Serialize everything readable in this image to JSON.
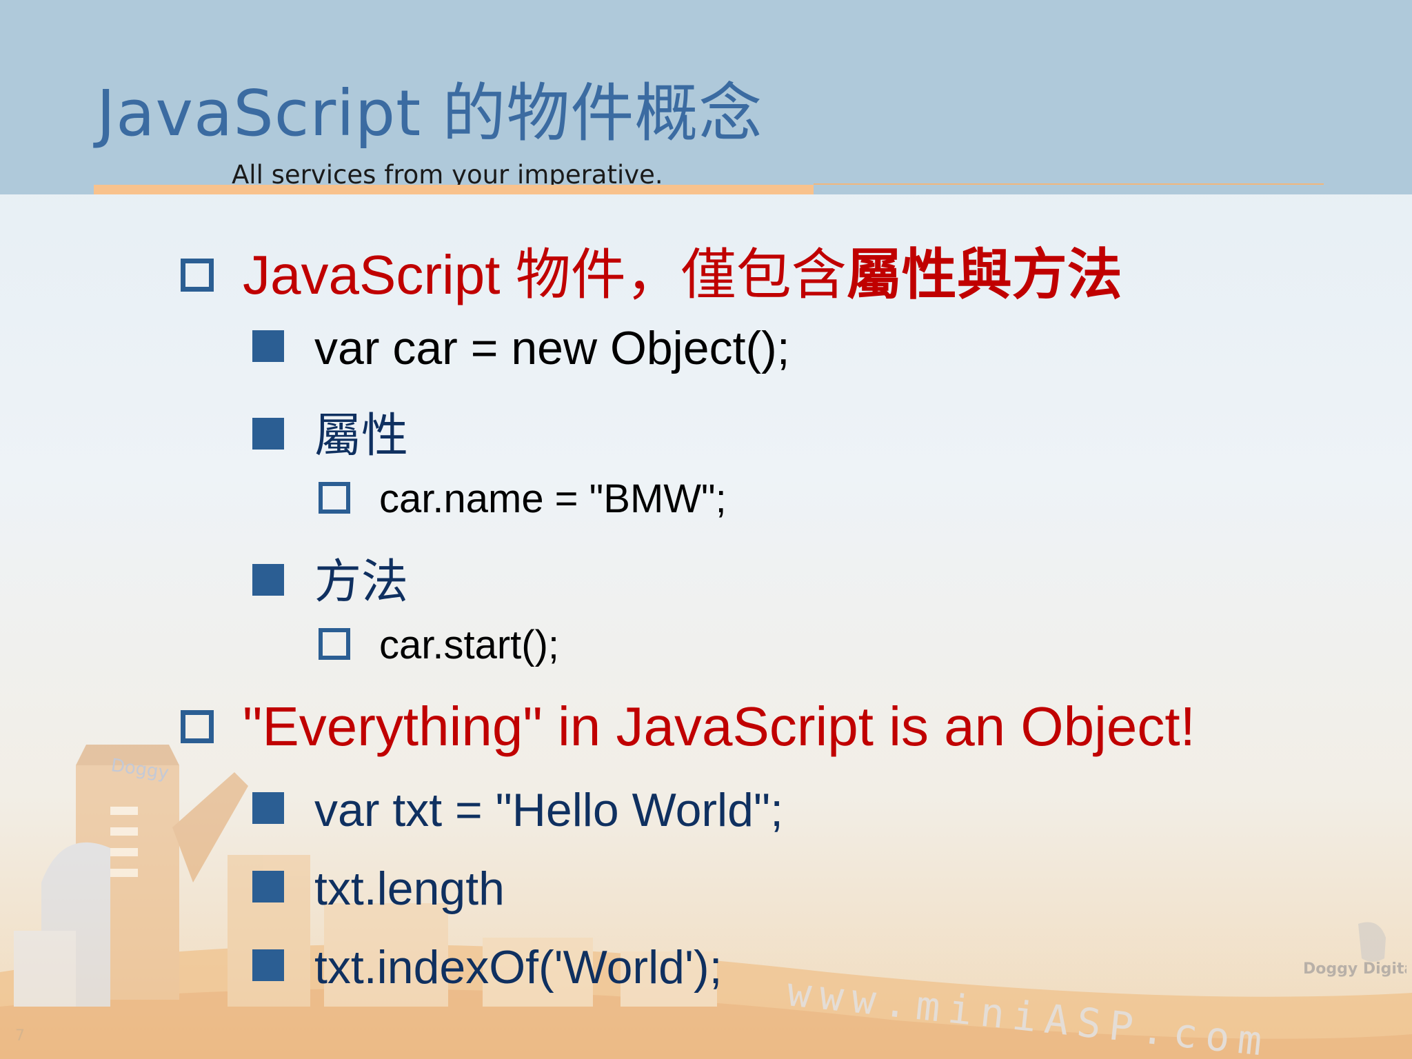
{
  "title": "JavaScript 的物件概念",
  "subtitle": "All services from your imperative.",
  "bullets": {
    "b1": {
      "prefix": "JavaScript 物件，僅包含",
      "emph": "屬性與方法"
    },
    "b1_1": "var car = new Object();",
    "b1_2": "屬性",
    "b1_2_1": "car.name = \"BMW\";",
    "b1_3": "方法",
    "b1_3_1": "car.start();",
    "b2": "\"Everything\" in JavaScript is an Object!",
    "b2_1": "var txt = \"Hello World\";",
    "b2_2": "txt.length",
    "b2_3": "txt.indexOf('World');"
  },
  "decor": {
    "building_sign": "Doggy",
    "watermark": "www.miniASP.com",
    "logo": "Doggy Digital Creative",
    "page_number": "7"
  },
  "colors": {
    "header_bg": "#afc9da",
    "title": "#3b6ba1",
    "accent_red": "#c00000",
    "bullet_blue": "#2b5e93",
    "navy_text": "#0f3060",
    "rule_orange": "#f8c28d"
  }
}
